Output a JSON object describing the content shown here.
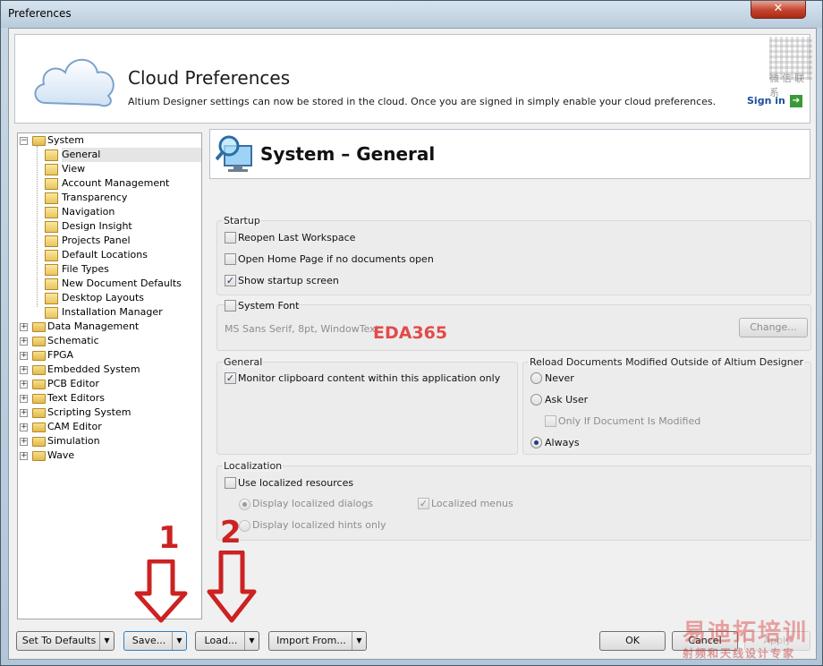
{
  "window": {
    "title": "Preferences",
    "close_glyph": "✕"
  },
  "banner": {
    "title": "Cloud Preferences",
    "description": "Altium Designer settings can now be stored in the cloud. Once you are signed in simply enable your cloud preferences.",
    "sign_in": "Sign in",
    "watermark_cn": "微信联系"
  },
  "tree": {
    "root": "System",
    "children": [
      "General",
      "View",
      "Account Management",
      "Transparency",
      "Navigation",
      "Design Insight",
      "Projects Panel",
      "Default Locations",
      "File Types",
      "New Document Defaults",
      "Desktop Layouts",
      "Installation Manager"
    ],
    "selected": "General",
    "other_roots": [
      "Data Management",
      "Schematic",
      "FPGA",
      "Embedded System",
      "PCB Editor",
      "Text Editors",
      "Scripting System",
      "CAM Editor",
      "Simulation",
      "Wave"
    ]
  },
  "page": {
    "title": "System – General"
  },
  "startup": {
    "label": "Startup",
    "reopen": "Reopen Last Workspace",
    "home": "Open Home Page if no documents open",
    "splash": "Show startup screen",
    "reopen_checked": false,
    "home_checked": false,
    "splash_checked": true
  },
  "system_font": {
    "label": "System Font",
    "value": "MS Sans Serif, 8pt, WindowText",
    "change": "Change...",
    "checked": false
  },
  "general": {
    "label": "General",
    "monitor": "Monitor clipboard content within this application only",
    "monitor_checked": true
  },
  "reload": {
    "label": "Reload Documents Modified Outside of Altium Designer",
    "never": "Never",
    "ask": "Ask User",
    "only_if": "Only If Document Is Modified",
    "always": "Always",
    "selected": "Always"
  },
  "localization": {
    "label": "Localization",
    "use": "Use localized resources",
    "dialogs": "Display localized dialogs",
    "hints": "Display localized hints only",
    "menus": "Localized menus"
  },
  "footer": {
    "defaults": "Set To Defaults",
    "save": "Save...",
    "load": "Load...",
    "import": "Import From...",
    "ok": "OK",
    "cancel": "Cancel",
    "apply": "Apply"
  },
  "annotations": {
    "n1": "1",
    "n2": "2",
    "eda": "EDA365"
  },
  "watermark": {
    "line1": "易迪拓培训",
    "line2": "射频和天线设计专家"
  },
  "colors": {
    "annotation_red": "#cc2222",
    "link_blue": "#1a4f9c",
    "selection_gray": "#e5e5e5"
  }
}
